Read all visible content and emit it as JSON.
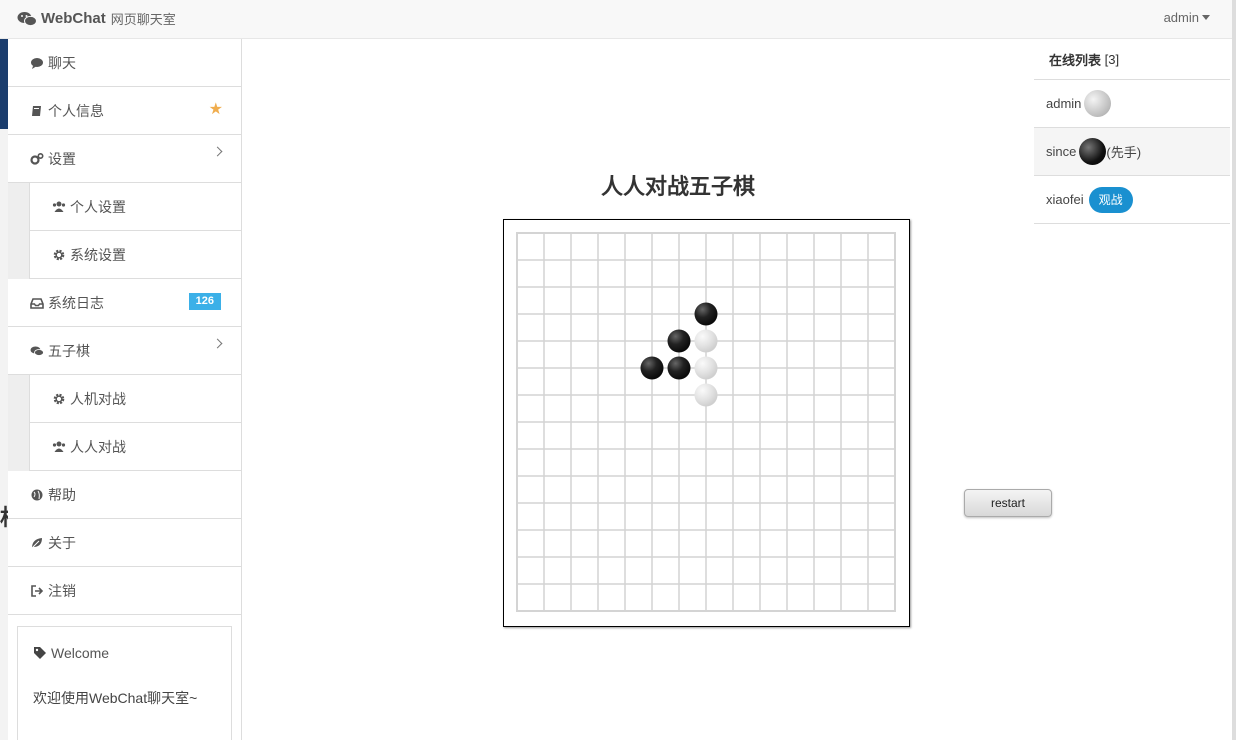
{
  "navbar": {
    "brand_name": "WebChat",
    "brand_sub": "网页聊天室",
    "user": "admin"
  },
  "sidebar": {
    "items": [
      {
        "label": "聊天",
        "icon": "comment-icon"
      },
      {
        "label": "个人信息",
        "icon": "book-icon",
        "star": "★"
      },
      {
        "label": "设置",
        "icon": "cogs-icon"
      },
      {
        "label": "个人设置",
        "icon": "users-icon"
      },
      {
        "label": "系统设置",
        "icon": "gear-icon"
      },
      {
        "label": "系统日志",
        "icon": "inbox-icon",
        "badge": "126"
      },
      {
        "label": "五子棋",
        "icon": "comments-icon"
      },
      {
        "label": "人机对战",
        "icon": "gear-icon"
      },
      {
        "label": "人人对战",
        "icon": "users-icon"
      },
      {
        "label": "帮助",
        "icon": "globe-icon"
      },
      {
        "label": "关于",
        "icon": "leaf-icon"
      },
      {
        "label": "注销",
        "icon": "sign-out-icon"
      }
    ],
    "welcome_title": "Welcome",
    "welcome_text": "欢迎使用WebChat聊天室~"
  },
  "main": {
    "title": "人人对战五子棋",
    "restart_label": "restart",
    "board": {
      "size": 15,
      "black_stones": [
        [
          7,
          3
        ],
        [
          6,
          4
        ],
        [
          5,
          5
        ],
        [
          6,
          5
        ]
      ],
      "white_stones": [
        [
          7,
          4
        ],
        [
          7,
          5
        ],
        [
          7,
          6
        ]
      ]
    }
  },
  "online": {
    "title": "在线列表",
    "count": "[3]",
    "users": [
      {
        "name": "admin",
        "stone": "white"
      },
      {
        "name": "since",
        "stone": "black",
        "note": "(先手)"
      },
      {
        "name": "xiaofei",
        "action": "观战"
      }
    ]
  },
  "peek": "相"
}
